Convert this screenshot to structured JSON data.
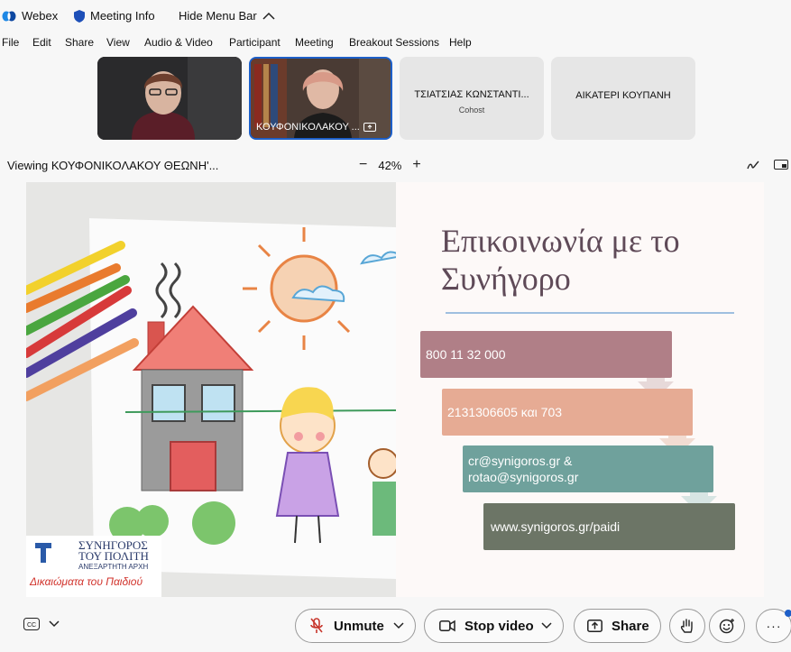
{
  "titlebar": {
    "app_name": "Webex",
    "meeting_info": "Meeting Info",
    "hide_menu": "Hide Menu Bar"
  },
  "menu": [
    "File",
    "Edit",
    "Share",
    "View",
    "Audio & Video",
    "Participant",
    "Meeting",
    "Breakout Sessions",
    "Help"
  ],
  "participants": [
    {
      "name": "",
      "type": "video"
    },
    {
      "name": "ΚΟΥΦΟΝΙΚΟΛΑΚΟΥ ...",
      "type": "video",
      "active": true
    },
    {
      "name": "ΤΣΙΑΤΣΙΑΣ ΚΩΝΣΤΑΝΤΙ...",
      "role": "Cohost",
      "type": "name"
    },
    {
      "name": "ΑΙΚΑΤΕΡΙ ΚΟΥΠΑΝΗ",
      "type": "name"
    }
  ],
  "viewing": {
    "label": "Viewing ΚΟΥΦΟΝΙΚΟΛΑΚΟΥ ΘΕΩΝΗ'...",
    "zoom_minus": "−",
    "zoom_level": "42%",
    "zoom_plus": "+"
  },
  "slide": {
    "title": "Επικοινωνία με το Συνήγορο",
    "logo_line1": "ΣΥΝΗΓΟΡΟΣ",
    "logo_line2": "ΤΟΥ ΠΟΛΙΤΗ",
    "logo_line3": "ΑΝΕΞΑΡΤΗΤΗ ΑΡΧΗ",
    "logo_tagline": "Δικαιώματα του Παιδιού",
    "phone1": "800 11 32 000",
    "phone2": "2131306605 και 703",
    "email1": "cr@synigoros.gr",
    "email_joiner": " &",
    "email2": "rotao@synigoros.gr",
    "website": "www.synigoros.gr/paidi",
    "colors": {
      "box1": "#b07f87",
      "box2": "#e6ab94",
      "box3": "#6fa19c",
      "box4": "#6c7566"
    }
  },
  "toolbar": {
    "unmute": "Unmute",
    "stop_video": "Stop video",
    "share": "Share"
  },
  "colors": {
    "active_border": "#1d5fc8",
    "notification_dot": "#1d5fc8",
    "mute_red": "#c8372d"
  }
}
